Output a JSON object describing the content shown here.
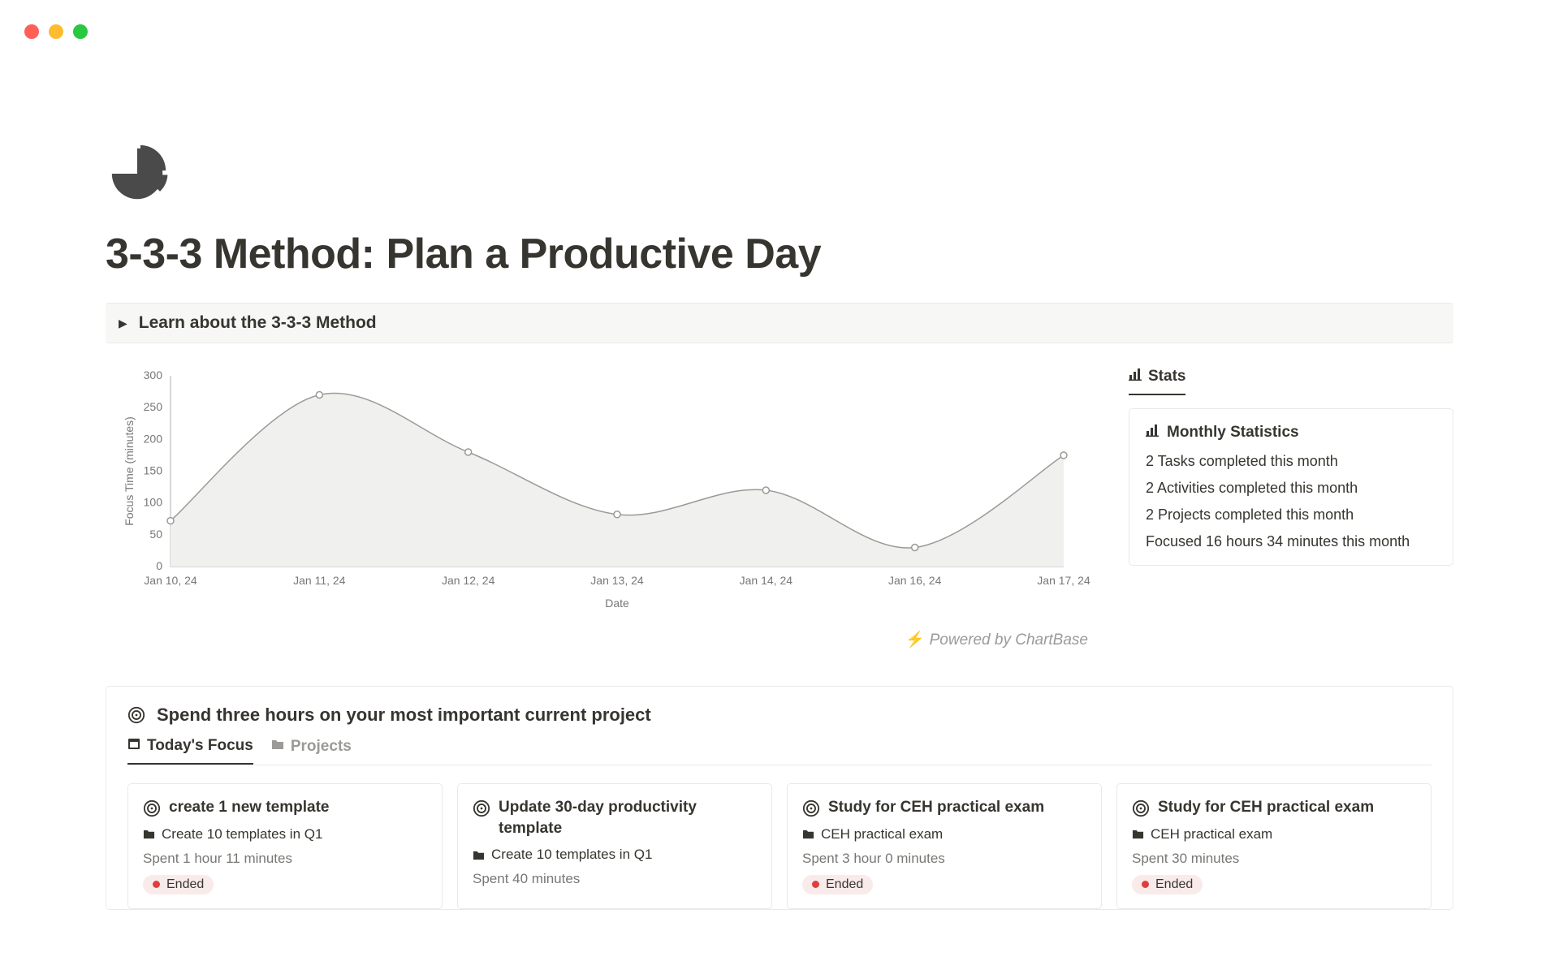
{
  "page": {
    "title": "3-3-3 Method: Plan a Productive Day",
    "callout": "Learn about the 3-3-3 Method"
  },
  "chart_data": {
    "type": "area",
    "title": "",
    "xlabel": "Date",
    "ylabel": "Focus Time (minutes)",
    "ylim": [
      0,
      300
    ],
    "yticks": [
      0,
      50,
      100,
      150,
      200,
      250,
      300
    ],
    "categories": [
      "Jan 10, 24",
      "Jan 11, 24",
      "Jan 12, 24",
      "Jan 13, 24",
      "Jan 14, 24",
      "Jan 16, 24",
      "Jan 17, 24"
    ],
    "values": [
      72,
      270,
      180,
      82,
      120,
      30,
      175
    ],
    "attribution": "Powered by ChartBase"
  },
  "stats": {
    "tab_label": "Stats",
    "card_title": "Monthly Statistics",
    "lines": [
      "2 Tasks completed this month",
      "2 Activities completed this month",
      "2 Projects completed this month",
      "Focused 16 hours 34 minutes this month"
    ]
  },
  "focus_section": {
    "heading": "Spend three hours on your most important current project",
    "tabs": [
      {
        "label": "Today's Focus",
        "active": true
      },
      {
        "label": "Projects",
        "active": false
      }
    ],
    "cards": [
      {
        "title": "create 1 new template",
        "project": "Create 10 templates in Q1",
        "spent": "Spent 1 hour 11 minutes",
        "status": "Ended"
      },
      {
        "title": "Update 30-day productivity template",
        "project": "Create 10 templates in Q1",
        "spent": "Spent 40 minutes",
        "status": ""
      },
      {
        "title": "Study for CEH practical exam",
        "project": "CEH practical exam",
        "spent": "Spent 3 hour 0 minutes",
        "status": "Ended"
      },
      {
        "title": "Study for CEH practical exam",
        "project": "CEH practical exam",
        "spent": "Spent 30 minutes",
        "status": "Ended"
      }
    ]
  }
}
